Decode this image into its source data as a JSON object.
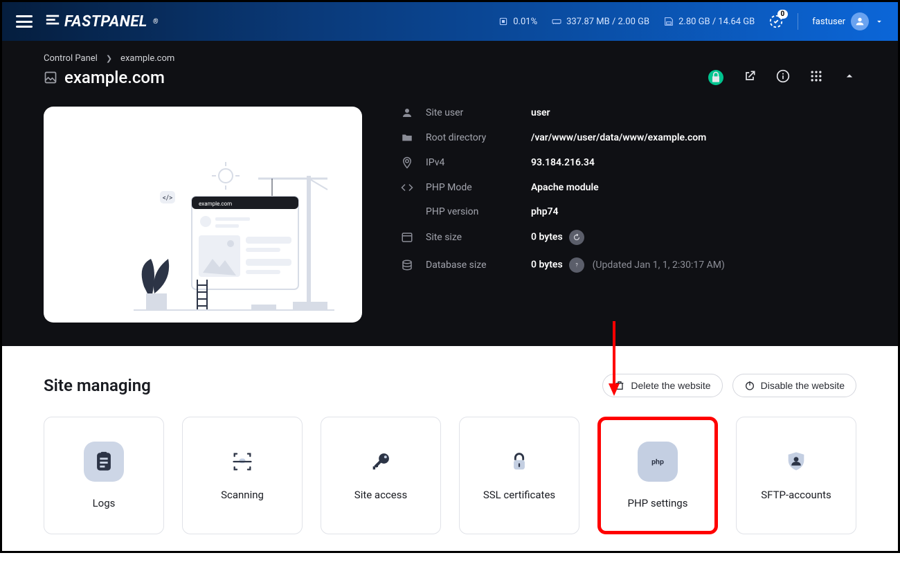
{
  "topbar": {
    "cpu": "0.01%",
    "ram": "337.87 MB / 2.00 GB",
    "disk": "2.80 GB / 14.64 GB",
    "notif_count": "0",
    "username": "fastuser",
    "brand": "FASTPANEL"
  },
  "breadcrumb": {
    "root": "Control Panel",
    "site": "example.com"
  },
  "page_title": "example.com",
  "info": {
    "site_user_label": "Site user",
    "site_user": "user",
    "root_dir_label": "Root directory",
    "root_dir": "/var/www/user/data/www/example.com",
    "ipv4_label": "IPv4",
    "ipv4": "93.184.216.34",
    "php_mode_label": "PHP Mode",
    "php_mode": "Apache module",
    "php_version_label": "PHP version",
    "php_version": "php74",
    "site_size_label": "Site size",
    "site_size": "0 bytes",
    "db_size_label": "Database size",
    "db_size": "0 bytes",
    "db_updated": "(Updated Jan 1, 1, 2:30:17 AM)"
  },
  "managing": {
    "heading": "Site managing",
    "delete_btn": "Delete the website",
    "disable_btn": "Disable the website"
  },
  "cards": {
    "logs": "Logs",
    "scanning": "Scanning",
    "site_access": "Site access",
    "ssl": "SSL certificates",
    "php": "PHP settings",
    "sftp": "SFTP-accounts"
  },
  "preview_domain": "example.com"
}
